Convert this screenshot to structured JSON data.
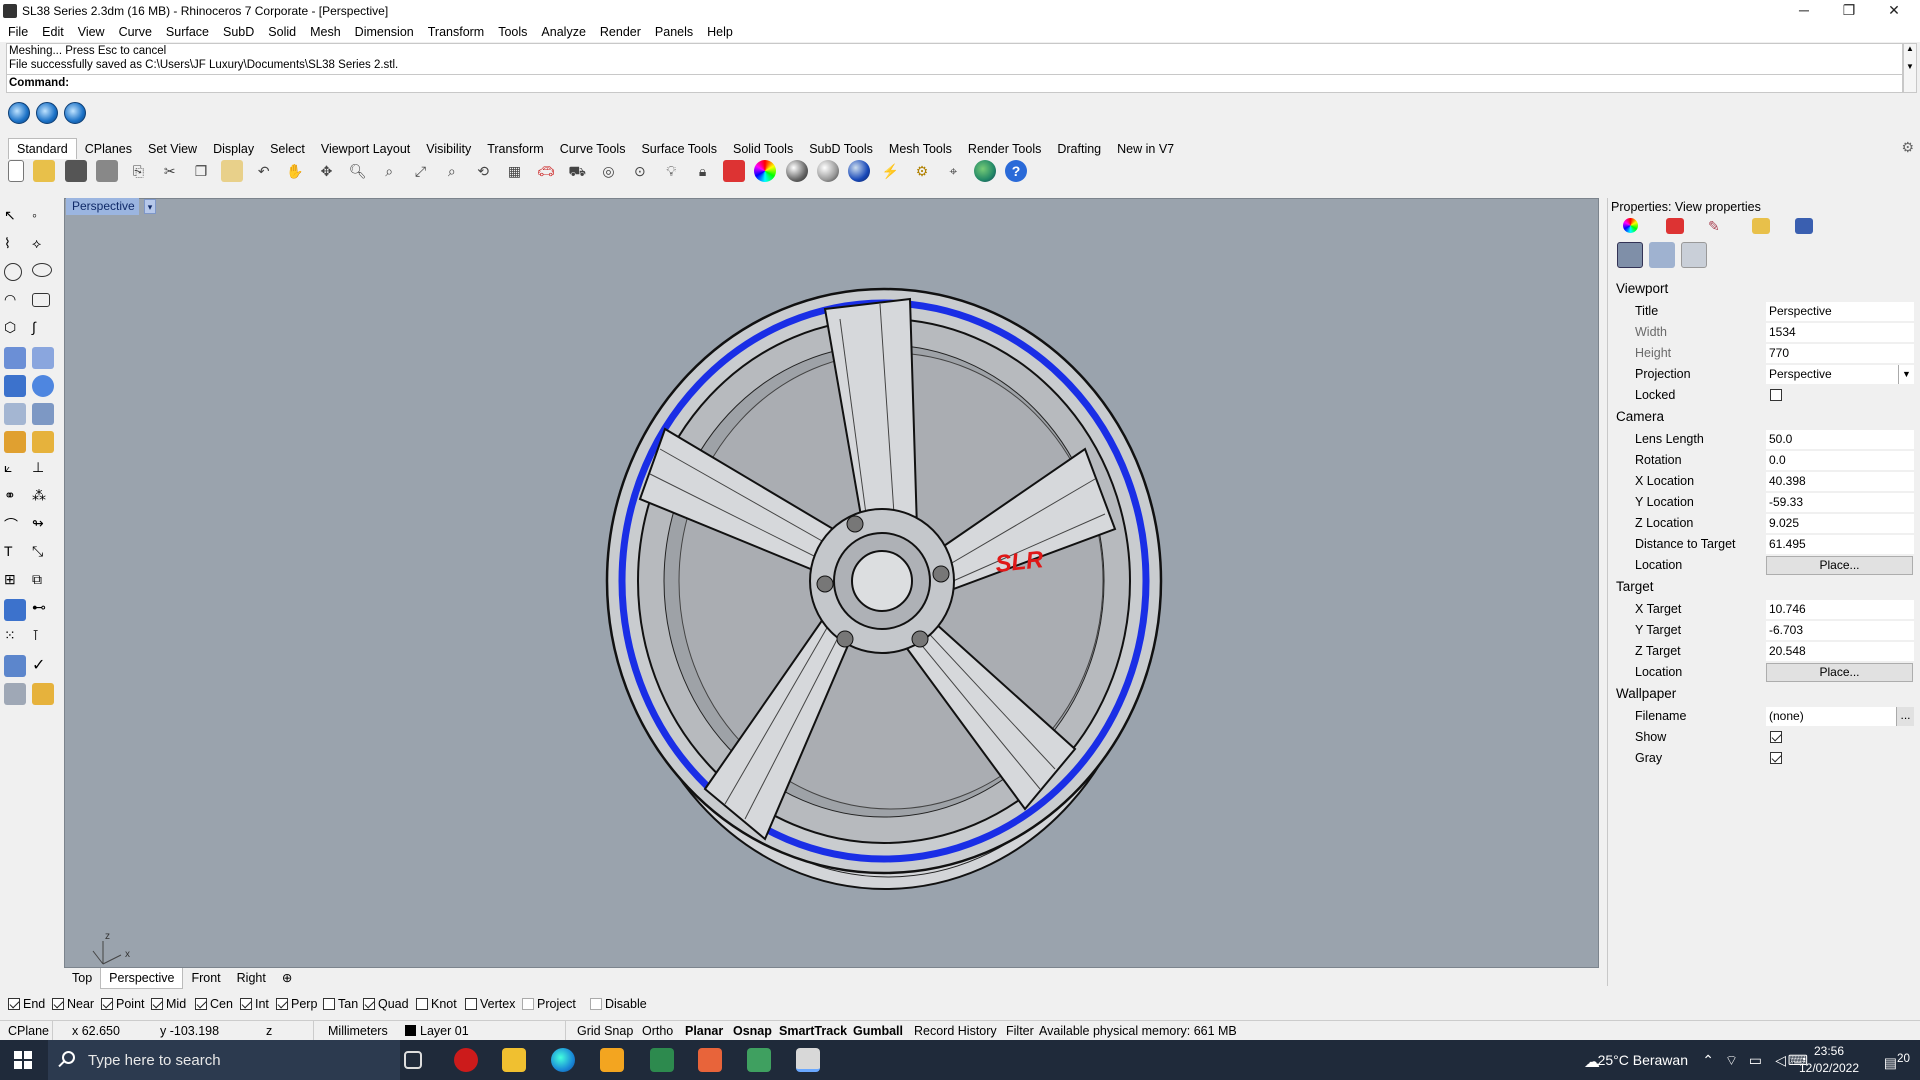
{
  "window": {
    "title": "SL38 Series 2.3dm (16 MB) - Rhinoceros 7 Corporate - [Perspective]",
    "minimize": "─",
    "restore": "❐",
    "close": "✕"
  },
  "menu": [
    "File",
    "Edit",
    "View",
    "Curve",
    "Surface",
    "SubD",
    "Solid",
    "Mesh",
    "Dimension",
    "Transform",
    "Tools",
    "Analyze",
    "Render",
    "Panels",
    "Help"
  ],
  "command_history": {
    "line1": "Meshing... Press Esc to cancel",
    "line2": "File successfully saved as C:\\Users\\JF Luxury\\Documents\\SL38 Series 2.stl.",
    "prompt": "Command:"
  },
  "toolbar_tabs": [
    "Standard",
    "CPlanes",
    "Set View",
    "Display",
    "Select",
    "Viewport Layout",
    "Visibility",
    "Transform",
    "Curve Tools",
    "Surface Tools",
    "Solid Tools",
    "SubD Tools",
    "Mesh Tools",
    "Render Tools",
    "Drafting",
    "New in V7"
  ],
  "viewport": {
    "title": "Perspective",
    "dropdown": "▾",
    "axes": {
      "x": "x",
      "y": "y",
      "z": "z"
    },
    "brand_text": "SLR"
  },
  "viewport_tabs": [
    "Top",
    "Perspective",
    "Front",
    "Right",
    "⊕"
  ],
  "osnaps": [
    {
      "label": "End",
      "checked": true
    },
    {
      "label": "Near",
      "checked": true
    },
    {
      "label": "Point",
      "checked": true
    },
    {
      "label": "Mid",
      "checked": true
    },
    {
      "label": "Cen",
      "checked": true
    },
    {
      "label": "Int",
      "checked": true
    },
    {
      "label": "Perp",
      "checked": true
    },
    {
      "label": "Tan",
      "checked": false
    },
    {
      "label": "Quad",
      "checked": true
    },
    {
      "label": "Knot",
      "checked": false
    },
    {
      "label": "Vertex",
      "checked": false
    },
    {
      "label": "Project",
      "checked": false
    },
    {
      "label": "Disable",
      "checked": false
    }
  ],
  "status": {
    "cplane": "CPlane",
    "x": "x 62.650",
    "y": "y -103.198",
    "z": "z",
    "units": "Millimeters",
    "layer": "Layer 01",
    "grid_snap": "Grid Snap",
    "ortho": "Ortho",
    "planar": "Planar",
    "osnap": "Osnap",
    "smarttrack": "SmartTrack",
    "gumball": "Gumball",
    "record_history": "Record History",
    "filter": "Filter",
    "memory": "Available physical memory: 661 MB"
  },
  "properties": {
    "title": "Properties: View properties",
    "viewport_section": "Viewport",
    "title_label": "Title",
    "title_value": "Perspective",
    "width_label": "Width",
    "width_value": "1534",
    "height_label": "Height",
    "height_value": "770",
    "projection_label": "Projection",
    "projection_value": "Perspective",
    "locked_label": "Locked",
    "camera_section": "Camera",
    "lens_label": "Lens Length",
    "lens_value": "50.0",
    "rotation_label": "Rotation",
    "rotation_value": "0.0",
    "xloc_label": "X Location",
    "xloc_value": "40.398",
    "yloc_label": "Y Location",
    "yloc_value": "-59.33",
    "zloc_label": "Z Location",
    "zloc_value": "9.025",
    "dist_label": "Distance to Target",
    "dist_value": "61.495",
    "location_label": "Location",
    "place_button": "Place...",
    "target_section": "Target",
    "xt_label": "X Target",
    "xt_value": "10.746",
    "yt_label": "Y Target",
    "yt_value": "-6.703",
    "zt_label": "Z Target",
    "zt_value": "20.548",
    "tloc_label": "Location",
    "tplace_button": "Place...",
    "wallpaper_section": "Wallpaper",
    "filename_label": "Filename",
    "filename_value": "(none)",
    "filename_button": "...",
    "show_label": "Show",
    "gray_label": "Gray"
  },
  "taskbar": {
    "search_placeholder": "Type here to search",
    "weather": "25°C Berawan",
    "time": "23:56",
    "date": "12/02/2022",
    "notification_count": "20"
  },
  "colors": {
    "viewport_bg": "#9aa3ad",
    "rim_highlight": "#1a2ee6",
    "brand_red": "#e01818",
    "taskbar": "#1f2a3a",
    "viewport_title": "#9bb5e0"
  }
}
